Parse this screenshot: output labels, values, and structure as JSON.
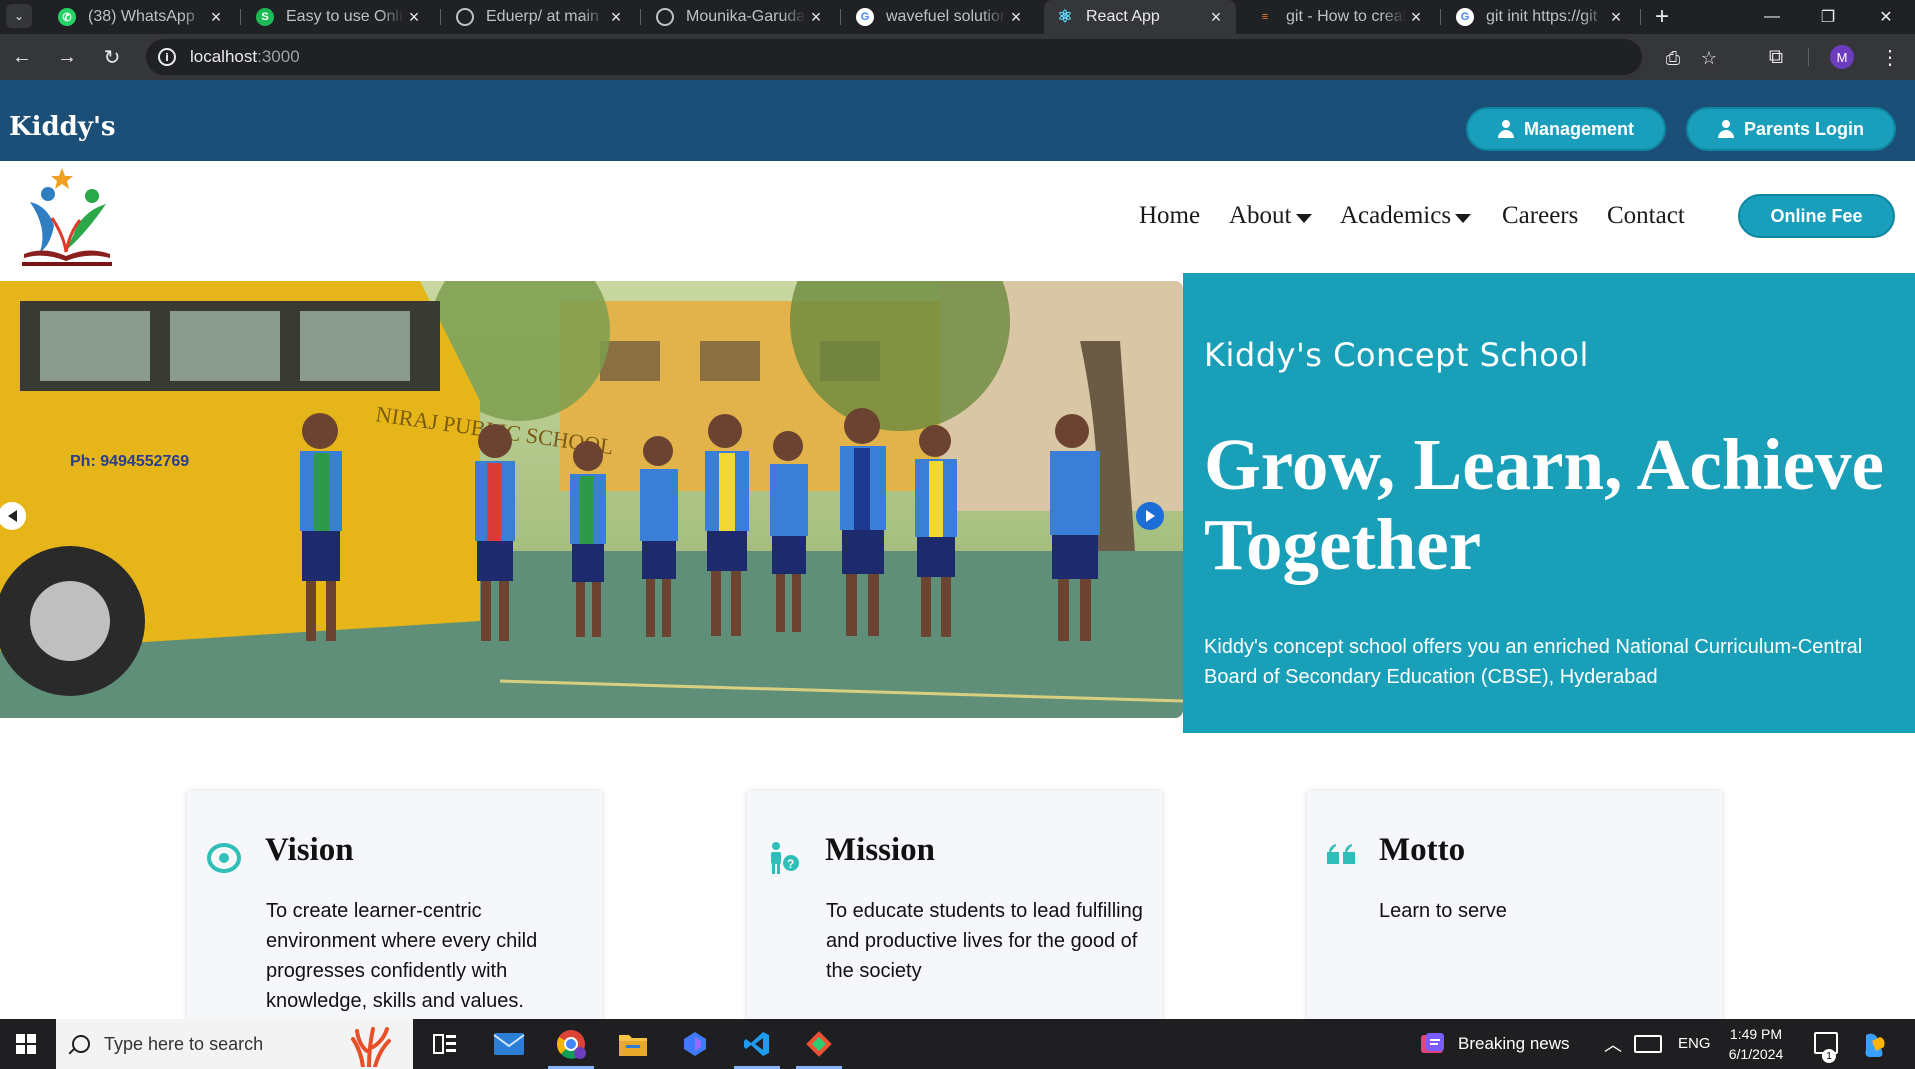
{
  "browser": {
    "tabs": [
      {
        "title": "(38) WhatsApp",
        "favicon": "whatsapp-icon",
        "color": "#25d366"
      },
      {
        "title": "Easy to use Online",
        "favicon": "s-icon",
        "color": "#1db954"
      },
      {
        "title": "Eduerp/ at main",
        "favicon": "github-icon",
        "color": "#202124"
      },
      {
        "title": "Mounika-Garuda",
        "favicon": "github-icon",
        "color": "#202124"
      },
      {
        "title": "wavefuel solutions",
        "favicon": "google-icon",
        "color": "#ffffff"
      },
      {
        "title": "React App",
        "favicon": "react-icon",
        "color": "#61dafb"
      },
      {
        "title": "git - How to create",
        "favicon": "stackoverflow-icon",
        "color": "#f48024"
      },
      {
        "title": "git init https://git",
        "favicon": "google-icon",
        "color": "#ffffff"
      }
    ],
    "active_tab": 5,
    "url": {
      "host": "localhost",
      "port": ":3000"
    },
    "profile_initial": "M"
  },
  "site": {
    "brand": "Kiddy's",
    "buttons": {
      "management": "Management",
      "parents_login": "Parents Login",
      "online_fee": "Online Fee"
    },
    "nav": [
      {
        "label": "Home",
        "dropdown": false
      },
      {
        "label": "About",
        "dropdown": true
      },
      {
        "label": "Academics",
        "dropdown": true
      },
      {
        "label": "Careers",
        "dropdown": false
      },
      {
        "label": "Contact",
        "dropdown": false
      }
    ],
    "hero": {
      "bus_phone": "Ph: 9494552769",
      "bus_school": "NIRAJ PUBLIC SCHOOL",
      "subtitle": "Kiddy's Concept School",
      "title": "Grow, Learn, Achieve Together",
      "description": "Kiddy's concept school offers you an enriched National Curriculum-Central Board of Secondary Education (CBSE), Hyderabad"
    },
    "cards": [
      {
        "title": "Vision",
        "icon": "eye-icon",
        "text": "To create learner-centric environment where every child progresses confidently with knowledge, skills and values."
      },
      {
        "title": "Mission",
        "icon": "person-question-icon",
        "text": "To educate students to lead fulfilling and productive lives for the good of the society"
      },
      {
        "title": "Motto",
        "icon": "quote-icon",
        "text": "Learn to serve"
      }
    ],
    "colors": {
      "header": "#1c4f78",
      "accent": "#199fbc",
      "hero_panel": "#199fb8"
    }
  },
  "taskbar": {
    "search_placeholder": "Type here to search",
    "news": "Breaking news",
    "language": "ENG",
    "time": "1:49 PM",
    "date": "6/1/2024",
    "notification_count": "1"
  }
}
